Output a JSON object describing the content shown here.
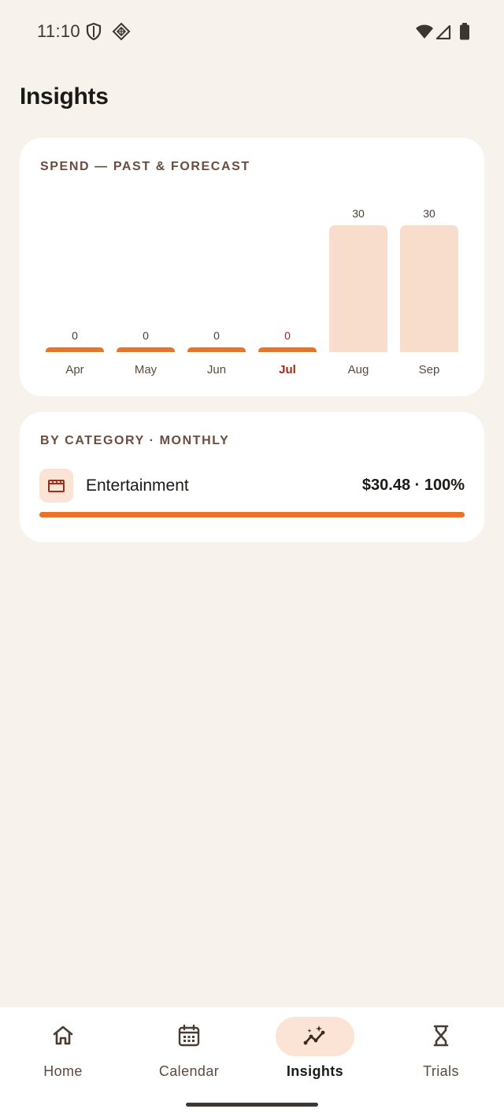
{
  "status_bar": {
    "time": "11:10",
    "icons_left": [
      "shield-icon",
      "vpn-diamond-icon"
    ],
    "icons_right": [
      "wifi-icon",
      "cellular-signal-icon",
      "battery-icon"
    ]
  },
  "page": {
    "title": "Insights"
  },
  "spend_card": {
    "heading": "SPEND — PAST & FORECAST"
  },
  "chart_data": {
    "type": "bar",
    "title": "SPEND — PAST & FORECAST",
    "categories": [
      "Apr",
      "May",
      "Jun",
      "Jul",
      "Aug",
      "Sep"
    ],
    "values": [
      0,
      0,
      0,
      0,
      30,
      30
    ],
    "value_labels": [
      "0",
      "0",
      "0",
      "0",
      "30",
      "30"
    ],
    "highlighted_category": "Jul",
    "kind": [
      "past",
      "past",
      "past",
      "past",
      "forecast",
      "forecast"
    ],
    "ylim": [
      0,
      30
    ],
    "grid": false,
    "colors": {
      "past": "#e8732a",
      "forecast": "#f8ddcd",
      "highlight_label": "#a52a14",
      "label": "#5a4a40"
    }
  },
  "category_card": {
    "heading": "BY CATEGORY · MONTHLY",
    "items": [
      {
        "icon": "film-clapper-icon",
        "name": "Entertainment",
        "amount": "$30.48 · 100%",
        "share": 1.0
      }
    ]
  },
  "bottom_nav": {
    "items": [
      {
        "label": "Home",
        "icon": "home-icon",
        "active": false
      },
      {
        "label": "Calendar",
        "icon": "calendar-icon",
        "active": false
      },
      {
        "label": "Insights",
        "icon": "insights-icon",
        "active": true
      },
      {
        "label": "Trials",
        "icon": "hourglass-icon",
        "active": false
      }
    ]
  },
  "colors": {
    "background": "#f7f3ec",
    "card": "#ffffff",
    "accent": "#e8732a",
    "accent_soft": "#fbe3d6",
    "heading": "#6d4c3d"
  }
}
